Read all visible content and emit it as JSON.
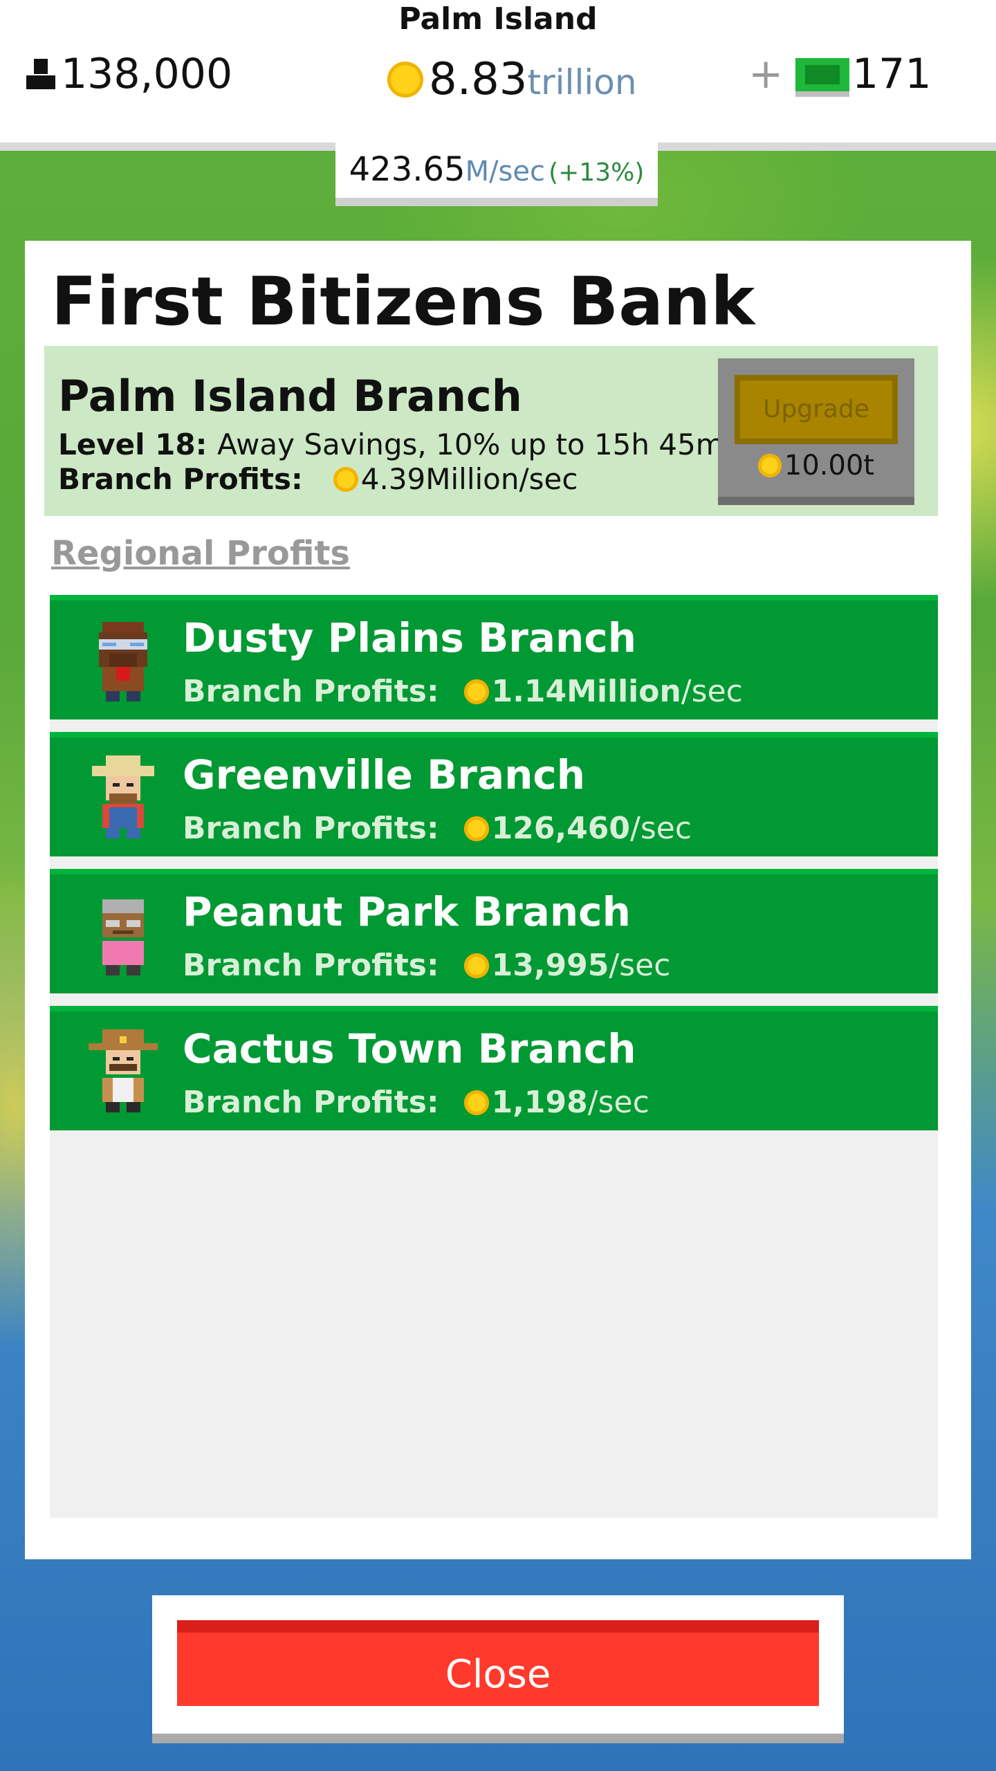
{
  "header": {
    "island_name": "Palm Island",
    "population": "138,000",
    "coins_value": "8.83",
    "coins_unit": "trillion",
    "plus_label": "+",
    "bux": "171",
    "rate_value": "423.65",
    "rate_unit": "M/sec",
    "rate_bonus": "(+13%)"
  },
  "panel": {
    "title": "First Bitizens Bank",
    "main_branch": {
      "name": "Palm Island Branch",
      "level_label": "Level 18:",
      "level_text": "Away Savings, 10% up to 15h 45m",
      "profits_label": "Branch Profits:",
      "profits_value": "4.39Million/sec",
      "upgrade_label": "Upgrade",
      "upgrade_cost": "10.00t"
    },
    "regional_label": "Regional Profits",
    "branches": [
      {
        "name": "Dusty Plains Branch",
        "profits_label": "Branch Profits:",
        "amount": "1.14Million",
        "unit": "/sec"
      },
      {
        "name": "Greenville Branch",
        "profits_label": "Branch Profits:",
        "amount": "126,460",
        "unit": "/sec"
      },
      {
        "name": "Peanut Park Branch",
        "profits_label": "Branch Profits:",
        "amount": "13,995",
        "unit": "/sec"
      },
      {
        "name": "Cactus Town Branch",
        "profits_label": "Branch Profits:",
        "amount": "1,198",
        "unit": "/sec"
      }
    ],
    "close_label": "Close"
  },
  "icons": {
    "population": "person-icon",
    "coin": "coin-icon",
    "bux": "cash-icon"
  },
  "colors": {
    "branch_row": "#009933",
    "main_branch_bg": "#cde8c4",
    "close_button": "#ff3a2c",
    "upgrade_disabled": "#a88400"
  }
}
